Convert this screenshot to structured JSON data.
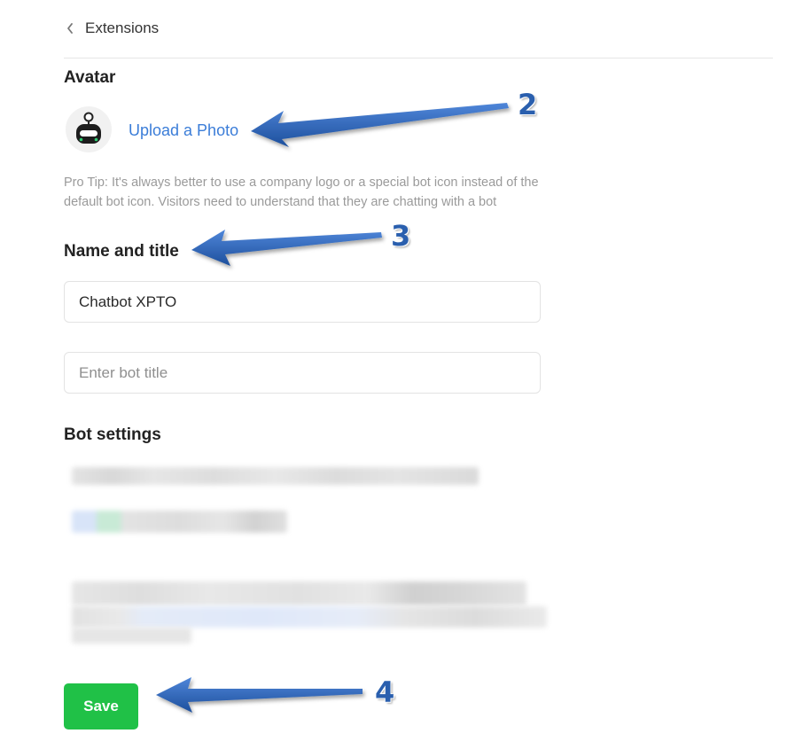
{
  "header": {
    "back_label": "Extensions"
  },
  "avatar_section": {
    "title": "Avatar",
    "upload_label": "Upload a Photo",
    "pro_tip": "Pro Tip: It's always better to use a company logo or a special bot icon instead of the default bot icon. Visitors need to understand that they are chatting with a bot"
  },
  "name_section": {
    "title": "Name and title",
    "name_value": "Chatbot XPTO",
    "title_placeholder": "Enter bot title"
  },
  "settings_section": {
    "title": "Bot settings"
  },
  "footer": {
    "save_label": "Save"
  },
  "annotations": {
    "step_2": "2",
    "step_3": "3",
    "step_4": "4"
  },
  "colors": {
    "link": "#3b7dd8",
    "save": "#20c147",
    "arrow": "#2a5fae"
  }
}
